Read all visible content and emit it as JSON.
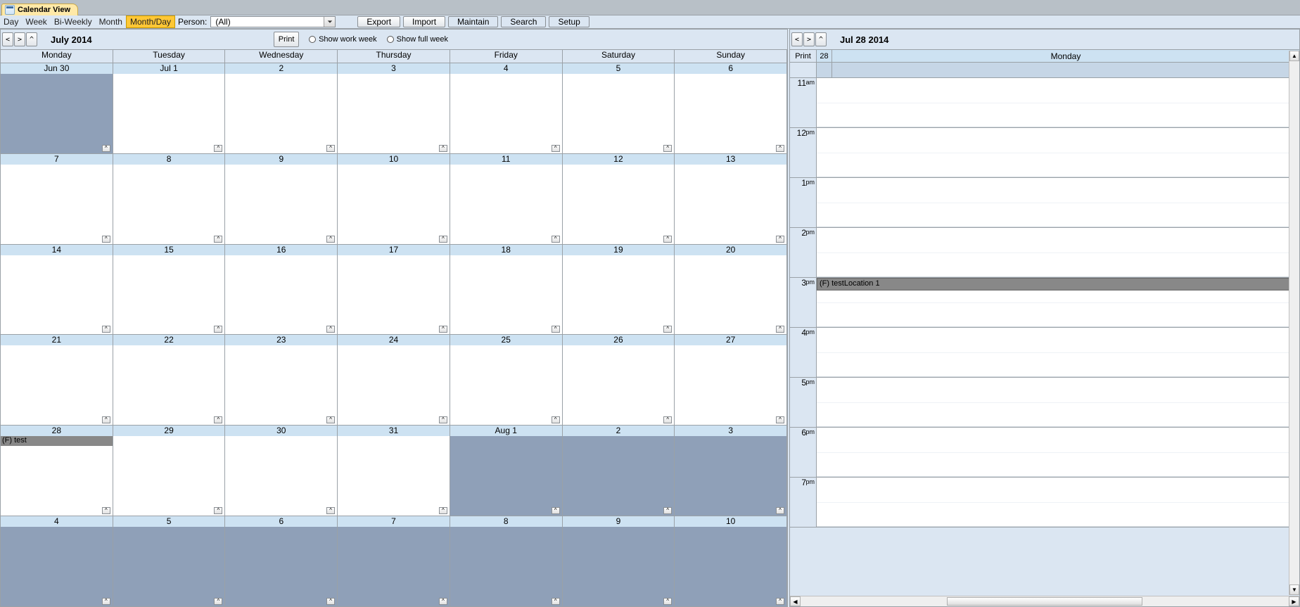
{
  "tab": {
    "label": "Calendar View"
  },
  "viewmodes": {
    "items": [
      "Day",
      "Week",
      "Bi-Weekly",
      "Month",
      "Month/Day"
    ],
    "active": "Month/Day"
  },
  "person": {
    "label": "Person:",
    "value": "(All)"
  },
  "toolbar": {
    "export": "Export",
    "import": "Import",
    "maintain": "Maintain",
    "search": "Search",
    "setup": "Setup"
  },
  "month_nav": {
    "prev": "<",
    "next": ">",
    "today": "^",
    "title": "July 2014",
    "print": "Print",
    "work_week": "Show work week",
    "full_week": "Show full week"
  },
  "dow": [
    "Monday",
    "Tuesday",
    "Wednesday",
    "Thursday",
    "Friday",
    "Saturday",
    "Sunday"
  ],
  "weeks": [
    {
      "dates": [
        "Jun 30",
        "Jul 1",
        "2",
        "3",
        "4",
        "5",
        "6"
      ],
      "out": [
        true,
        false,
        false,
        false,
        false,
        false,
        false
      ],
      "events": [
        null,
        null,
        null,
        null,
        null,
        null,
        null
      ]
    },
    {
      "dates": [
        "7",
        "8",
        "9",
        "10",
        "11",
        "12",
        "13"
      ],
      "out": [
        false,
        false,
        false,
        false,
        false,
        false,
        false
      ],
      "events": [
        null,
        null,
        null,
        null,
        null,
        null,
        null
      ]
    },
    {
      "dates": [
        "14",
        "15",
        "16",
        "17",
        "18",
        "19",
        "20"
      ],
      "out": [
        false,
        false,
        false,
        false,
        false,
        false,
        false
      ],
      "events": [
        null,
        null,
        null,
        null,
        null,
        null,
        null
      ]
    },
    {
      "dates": [
        "21",
        "22",
        "23",
        "24",
        "25",
        "26",
        "27"
      ],
      "out": [
        false,
        false,
        false,
        false,
        false,
        false,
        false
      ],
      "events": [
        null,
        null,
        null,
        null,
        null,
        null,
        null
      ]
    },
    {
      "dates": [
        "28",
        "29",
        "30",
        "31",
        "Aug 1",
        "2",
        "3"
      ],
      "out": [
        false,
        false,
        false,
        false,
        true,
        true,
        true
      ],
      "events": [
        "(F) test",
        null,
        null,
        null,
        null,
        null,
        null
      ]
    },
    {
      "dates": [
        "4",
        "5",
        "6",
        "7",
        "8",
        "9",
        "10"
      ],
      "out": [
        true,
        true,
        true,
        true,
        true,
        true,
        true
      ],
      "events": [
        null,
        null,
        null,
        null,
        null,
        null,
        null
      ]
    }
  ],
  "day_nav": {
    "prev": "<",
    "next": ">",
    "today": "^",
    "title": "Jul 28 2014",
    "print": "Print"
  },
  "day_header": {
    "date": "28",
    "dow": "Monday"
  },
  "hours": [
    {
      "n": "11",
      "ap": "am"
    },
    {
      "n": "12",
      "ap": "pm"
    },
    {
      "n": "1",
      "ap": "pm"
    },
    {
      "n": "2",
      "ap": "pm"
    },
    {
      "n": "3",
      "ap": "pm"
    },
    {
      "n": "4",
      "ap": "pm"
    },
    {
      "n": "5",
      "ap": "pm"
    },
    {
      "n": "6",
      "ap": "pm"
    },
    {
      "n": "7",
      "ap": "pm"
    }
  ],
  "day_event": {
    "text": "(F) testLocation 1",
    "hour_index": 4
  }
}
